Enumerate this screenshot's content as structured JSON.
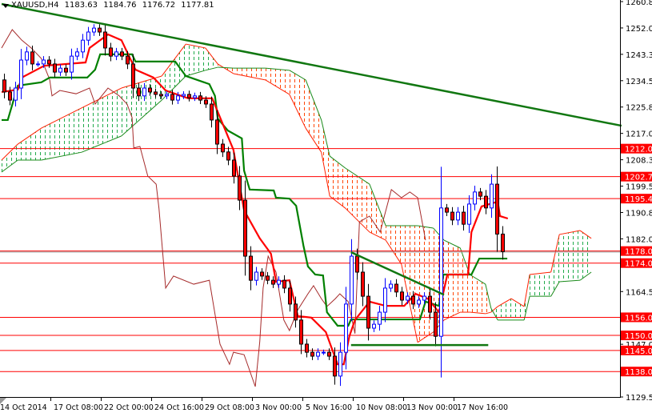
{
  "header": {
    "symbol": "XAUUSD,H4",
    "open": "1183.63",
    "high": "1184.76",
    "low": "1176.72",
    "close": "1177.81"
  },
  "colors": {
    "bull_candle": "#0000ff",
    "bear_candle": "#ff0000",
    "tenkan": "#ff0000",
    "kijun": "#008000",
    "chikou": "#a52a2a",
    "cloud_bull": "#1faa4a",
    "cloud_bear": "#ff4500",
    "level": "#ff0000",
    "trendline": "#117711"
  },
  "chart_data": {
    "type": "candlestick",
    "title": "XAUUSD,H4",
    "x_unit": "bar index (H4)",
    "ylim": [
      1129.55,
      1260.8
    ],
    "grid": false,
    "y_ticks": [
      "1260.80",
      "1252.05",
      "1243.30",
      "1234.55",
      "1225.80",
      "1217.05",
      "1208.30",
      "1199.55",
      "1190.80",
      "1182.05",
      "1164.55",
      "1147.05",
      "1129.55"
    ],
    "x_ticks": [
      {
        "idx": 0,
        "label": "14 Oct 2014"
      },
      {
        "idx": 9,
        "label": "17 Oct 08:00"
      },
      {
        "idx": 18,
        "label": "22 Oct 00:00"
      },
      {
        "idx": 27,
        "label": "24 Oct 16:00"
      },
      {
        "idx": 36,
        "label": "29 Oct 08:00"
      },
      {
        "idx": 45,
        "label": "3 Nov 00:00"
      },
      {
        "idx": 54,
        "label": "5 Nov 16:00"
      },
      {
        "idx": 63,
        "label": "10 Nov 08:00"
      },
      {
        "idx": 72,
        "label": "13 Nov 00:00"
      },
      {
        "idx": 81,
        "label": "17 Nov 16:00"
      }
    ],
    "closes": [
      1234.8,
      1230.8,
      1228.1,
      1232.1,
      1241.4,
      1244.1,
      1240.1,
      1240.1,
      1241.4,
      1240.1,
      1237.4,
      1238.7,
      1237.4,
      1242.7,
      1244.1,
      1248.0,
      1250.7,
      1252.0,
      1250.7,
      1245.4,
      1242.7,
      1244.1,
      1242.7,
      1240.1,
      1232.1,
      1229.5,
      1232.1,
      1230.8,
      1230.0,
      1229.5,
      1230.0,
      1228.1,
      1229.5,
      1230.0,
      1228.9,
      1229.5,
      1228.1,
      1226.8,
      1221.5,
      1213.5,
      1210.9,
      1208.2,
      1202.9,
      1194.9,
      1176.3,
      1168.3,
      1171.0,
      1169.7,
      1168.3,
      1167.0,
      1168.3,
      1165.7,
      1160.4,
      1155.1,
      1147.1,
      1144.4,
      1143.1,
      1144.4,
      1144.4,
      1143.1,
      1136.5,
      1144.4,
      1160.4,
      1176.3,
      1171.0,
      1163.0,
      1152.4,
      1153.7,
      1157.7,
      1165.7,
      1167.0,
      1164.4,
      1161.7,
      1163.0,
      1160.4,
      1161.7,
      1163.0,
      1157.7,
      1149.7,
      1192.3,
      1190.9,
      1188.3,
      1190.9,
      1186.9,
      1193.6,
      1197.6,
      1196.2,
      1192.3,
      1200.2,
      1183.63,
      1177.81
    ],
    "tenkan": [
      [
        0,
        1230.8
      ],
      [
        2.9,
        1231.6
      ],
      [
        3.6,
        1235.6
      ],
      [
        7.6,
        1239.5
      ],
      [
        15,
        1240.6
      ],
      [
        15.7,
        1245.4
      ],
      [
        19,
        1249.9
      ],
      [
        21.4,
        1248.0
      ],
      [
        23.9,
        1238.2
      ],
      [
        27.1,
        1235.6
      ],
      [
        29.3,
        1231.3
      ],
      [
        33.3,
        1228.7
      ],
      [
        37.6,
        1228.7
      ],
      [
        41.4,
        1211.6
      ],
      [
        43.3,
        1191.5
      ],
      [
        46.1,
        1182.2
      ],
      [
        48.1,
        1177.1
      ],
      [
        49,
        1167.8
      ],
      [
        51.4,
        1168.3
      ],
      [
        52.9,
        1156.4
      ],
      [
        55.3,
        1155.9
      ],
      [
        57.9,
        1151.1
      ],
      [
        60,
        1140.4
      ],
      [
        61.1,
        1140.4
      ],
      [
        62.1,
        1149.7
      ],
      [
        63.1,
        1155.1
      ],
      [
        65.7,
        1161.2
      ],
      [
        68.6,
        1159.8
      ],
      [
        71.9,
        1159.8
      ],
      [
        73.9,
        1163.8
      ],
      [
        76.1,
        1162.2
      ],
      [
        78.1,
        1157.7
      ],
      [
        79.6,
        1170.2
      ],
      [
        83.3,
        1170.2
      ],
      [
        83.9,
        1184.3
      ],
      [
        85.7,
        1192.8
      ],
      [
        88.6,
        1194.4
      ],
      [
        89,
        1189.6
      ],
      [
        90.4,
        1188.8
      ]
    ],
    "kijun": [
      [
        0,
        1221.5
      ],
      [
        1.1,
        1221.5
      ],
      [
        2.9,
        1232.9
      ],
      [
        7.1,
        1234.0
      ],
      [
        8.6,
        1235.6
      ],
      [
        15.3,
        1235.6
      ],
      [
        16.7,
        1238.2
      ],
      [
        17.6,
        1243.3
      ],
      [
        23.3,
        1243.3
      ],
      [
        23.9,
        1240.9
      ],
      [
        31,
        1240.9
      ],
      [
        32.9,
        1236.1
      ],
      [
        37.1,
        1233.4
      ],
      [
        38.1,
        1229.5
      ],
      [
        38.6,
        1222.0
      ],
      [
        40.4,
        1218.0
      ],
      [
        42.9,
        1215.4
      ],
      [
        43.3,
        1204.7
      ],
      [
        44.3,
        1198.4
      ],
      [
        48.6,
        1198.1
      ],
      [
        49,
        1195.7
      ],
      [
        51.4,
        1195.4
      ],
      [
        52.6,
        1193.0
      ],
      [
        53.9,
        1179.8
      ],
      [
        54.7,
        1172.9
      ],
      [
        56,
        1170.2
      ],
      [
        57.4,
        1169.9
      ],
      [
        58.1,
        1157.7
      ],
      [
        60,
        1153.2
      ],
      [
        61.9,
        1153.2
      ],
      [
        62.4,
        1155.3
      ],
      [
        74.7,
        1155.3
      ],
      [
        75.7,
        1161.2
      ],
      [
        78.1,
        1159.8
      ],
      [
        78.9,
        1170.2
      ],
      [
        83.9,
        1170.2
      ],
      [
        85.3,
        1175.5
      ],
      [
        90.3,
        1175.5
      ]
    ],
    "chikou": [
      [
        0,
        1245.4
      ],
      [
        1.9,
        1251.5
      ],
      [
        3.6,
        1248.0
      ],
      [
        5.3,
        1245.4
      ],
      [
        7.1,
        1241.9
      ],
      [
        8.6,
        1234.8
      ],
      [
        9,
        1229.5
      ],
      [
        10.4,
        1231.3
      ],
      [
        13.3,
        1230.2
      ],
      [
        15.7,
        1232.1
      ],
      [
        16.7,
        1226.8
      ],
      [
        19,
        1232.1
      ],
      [
        21,
        1229.5
      ],
      [
        22.4,
        1226.8
      ],
      [
        23.3,
        1222.3
      ],
      [
        23.6,
        1212.2
      ],
      [
        24.7,
        1212.7
      ],
      [
        26.1,
        1202.9
      ],
      [
        27.6,
        1200.2
      ],
      [
        28.1,
        1192.2
      ],
      [
        29.3,
        1165.7
      ],
      [
        30.7,
        1169.7
      ],
      [
        34.3,
        1167.0
      ],
      [
        37.1,
        1168.3
      ],
      [
        39,
        1147.1
      ],
      [
        40.7,
        1140.4
      ],
      [
        41.4,
        1144.4
      ],
      [
        43.3,
        1143.6
      ],
      [
        45.3,
        1133.0
      ],
      [
        46.1,
        1147.9
      ],
      [
        46.7,
        1165.7
      ],
      [
        47.6,
        1176.3
      ],
      [
        49,
        1171.0
      ],
      [
        50.4,
        1155.1
      ],
      [
        51.4,
        1151.6
      ],
      [
        52.9,
        1158.5
      ],
      [
        54.7,
        1163.8
      ],
      [
        55.7,
        1166.5
      ],
      [
        57.1,
        1162.2
      ],
      [
        58.1,
        1159.6
      ],
      [
        59.6,
        1162.2
      ],
      [
        60.4,
        1163.8
      ],
      [
        61.9,
        1161.2
      ],
      [
        63.1,
        1150.6
      ],
      [
        63.9,
        1187.7
      ],
      [
        65.7,
        1189.6
      ],
      [
        67.6,
        1184.3
      ],
      [
        69.6,
        1198.4
      ],
      [
        71.4,
        1195.7
      ],
      [
        72.9,
        1197.6
      ],
      [
        74.3,
        1195.7
      ],
      [
        75.7,
        1181.6
      ]
    ],
    "cloud": [
      [
        0,
        1208.2,
        1204.2
      ],
      [
        2.9,
        1213.5,
        1208.2
      ],
      [
        7.1,
        1218.8,
        1208.2
      ],
      [
        14.3,
        1225.5,
        1210.8
      ],
      [
        21.4,
        1232.1,
        1216.2
      ],
      [
        28.6,
        1236.1,
        1228.1
      ],
      [
        32.9,
        1246.7,
        1236.1
      ],
      [
        36.4,
        1245.4,
        1238.0
      ],
      [
        38.6,
        1240.1,
        1239.0
      ],
      [
        41.4,
        1236.9,
        1238.7
      ],
      [
        47.1,
        1234.8,
        1238.7
      ],
      [
        51.4,
        1230.0,
        1238.0
      ],
      [
        54.3,
        1218.8,
        1234.8
      ],
      [
        57.1,
        1210.8,
        1221.5
      ],
      [
        58.6,
        1196.2,
        1209.5
      ],
      [
        61.4,
        1192.2,
        1205.5
      ],
      [
        65.7,
        1184.3,
        1200.2
      ],
      [
        68.6,
        1181.6,
        1186.4
      ],
      [
        71.4,
        1173.6,
        1186.4
      ],
      [
        74.3,
        1147.7,
        1186.4
      ],
      [
        77.1,
        1151.1,
        1185.6
      ],
      [
        79,
        1155.1,
        1181.6
      ],
      [
        81.9,
        1157.7,
        1179.0
      ],
      [
        83.6,
        1157.7,
        1170.2
      ],
      [
        86.4,
        1157.2,
        1167.0
      ],
      [
        87.4,
        1157.7,
        1159.0
      ],
      [
        88.6,
        1159.6,
        1155.1
      ],
      [
        91,
        1162.2,
        1155.1
      ],
      [
        93.3,
        1159.6,
        1155.1
      ],
      [
        94.3,
        1170.2,
        1163.0
      ],
      [
        98.1,
        1171.0,
        1163.0
      ],
      [
        99.6,
        1183.5,
        1167.8
      ],
      [
        103.3,
        1184.8,
        1168.3
      ],
      [
        105.3,
        1182.2,
        1171.0
      ]
    ],
    "levels": [
      "1212.00",
      "1202.70",
      "1195.40",
      "1178.00",
      "1174.00",
      "1156.00",
      "1150.00",
      "1145.00",
      "1138.00"
    ],
    "trendlines": [
      {
        "name": "long-term-resistance",
        "from": [
          0,
          1260.0
        ],
        "to": [
          110.7,
          1219.6
        ]
      },
      {
        "name": "short-term-resistance",
        "from": [
          62.4,
          1177.6
        ],
        "to": [
          79,
          1163.5
        ]
      },
      {
        "name": "support",
        "from": [
          62.4,
          1146.8
        ],
        "to": [
          86.9,
          1146.8
        ]
      }
    ],
    "bid": 1177.81
  }
}
